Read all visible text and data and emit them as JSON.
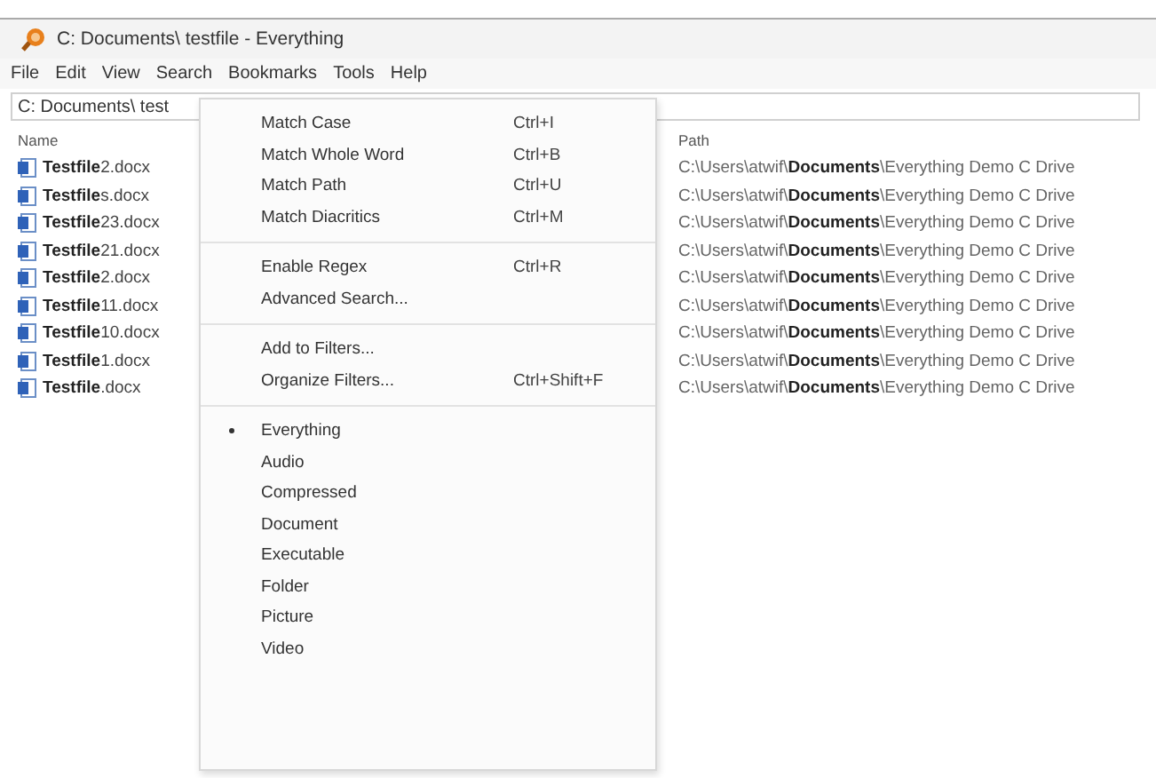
{
  "window": {
    "title": "C: Documents\\ testfile - Everything"
  },
  "menu_bar": [
    "File",
    "Edit",
    "View",
    "Search",
    "Bookmarks",
    "Tools",
    "Help"
  ],
  "search": {
    "value": "C: Documents\\ test"
  },
  "table": {
    "columns": [
      "Name",
      "Path"
    ],
    "rows": [
      {
        "name": "**Testfile**2.docx",
        "path": "C:\\Users\\atwif\\**Documents**\\Everything Demo C Drive"
      },
      {
        "name": "**Testfile**s.docx",
        "path": "C:\\Users\\atwif\\**Documents**\\Everything Demo C Drive"
      },
      {
        "name": "**Testfile**23.docx",
        "path": "C:\\Users\\atwif\\**Documents**\\Everything Demo C Drive"
      },
      {
        "name": "**Testfile**21.docx",
        "path": "C:\\Users\\atwif\\**Documents**\\Everything Demo C Drive"
      },
      {
        "name": "**Testfile**2.docx",
        "path": "C:\\Users\\atwif\\**Documents**\\Everything Demo C Drive"
      },
      {
        "name": "**Testfile**11.docx",
        "path": "C:\\Users\\atwif\\**Documents**\\Everything Demo C Drive"
      },
      {
        "name": "**Testfile**10.docx",
        "path": "C:\\Users\\atwif\\**Documents**\\Everything Demo C Drive"
      },
      {
        "name": "**Testfile**1.docx",
        "path": "C:\\Users\\atwif\\**Documents**\\Everything Demo C Drive"
      },
      {
        "name": "**Testfile**.docx",
        "path": "C:\\Users\\atwif\\**Documents**\\Everything Demo C Drive"
      }
    ]
  },
  "search_menu": [
    {
      "kind": "item",
      "label": "Match Case",
      "shortcut": "Ctrl+I"
    },
    {
      "kind": "item",
      "label": "Match Whole Word",
      "shortcut": "Ctrl+B"
    },
    {
      "kind": "item",
      "label": "Match Path",
      "shortcut": "Ctrl+U"
    },
    {
      "kind": "item",
      "label": "Match Diacritics",
      "shortcut": "Ctrl+M"
    },
    {
      "kind": "separator"
    },
    {
      "kind": "item",
      "label": "Enable Regex",
      "shortcut": "Ctrl+R"
    },
    {
      "kind": "item",
      "label": "Advanced Search..."
    },
    {
      "kind": "separator"
    },
    {
      "kind": "item",
      "label": "Add to Filters..."
    },
    {
      "kind": "item",
      "label": "Organize Filters...",
      "shortcut": "Ctrl+Shift+F"
    },
    {
      "kind": "separator"
    },
    {
      "kind": "filter",
      "label": "Everything",
      "selected": true
    },
    {
      "kind": "filter",
      "label": "Audio",
      "selected": false
    },
    {
      "kind": "filter",
      "label": "Compressed",
      "selected": false
    },
    {
      "kind": "filter",
      "label": "Document",
      "selected": false
    },
    {
      "kind": "filter",
      "label": "Executable",
      "selected": false
    },
    {
      "kind": "filter",
      "label": "Folder",
      "selected": false
    },
    {
      "kind": "filter",
      "label": "Picture",
      "selected": false
    },
    {
      "kind": "filter",
      "label": "Video",
      "selected": false
    }
  ]
}
